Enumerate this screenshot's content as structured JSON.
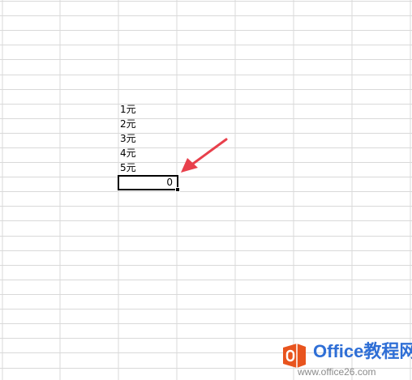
{
  "sheet": {
    "column_values": [
      "1元",
      "2元",
      "3元",
      "4元",
      "5元"
    ],
    "active_cell_value": "0"
  },
  "annotation": {
    "arrow_color": "#e8404c"
  },
  "watermark": {
    "brand": "Office教程网",
    "url": "www.office26.com",
    "logo_color": "#e8541e",
    "brand_color": "#2f6fd6"
  },
  "colors": {
    "gridline": "#d9d9d9",
    "cell_border": "#000000"
  }
}
